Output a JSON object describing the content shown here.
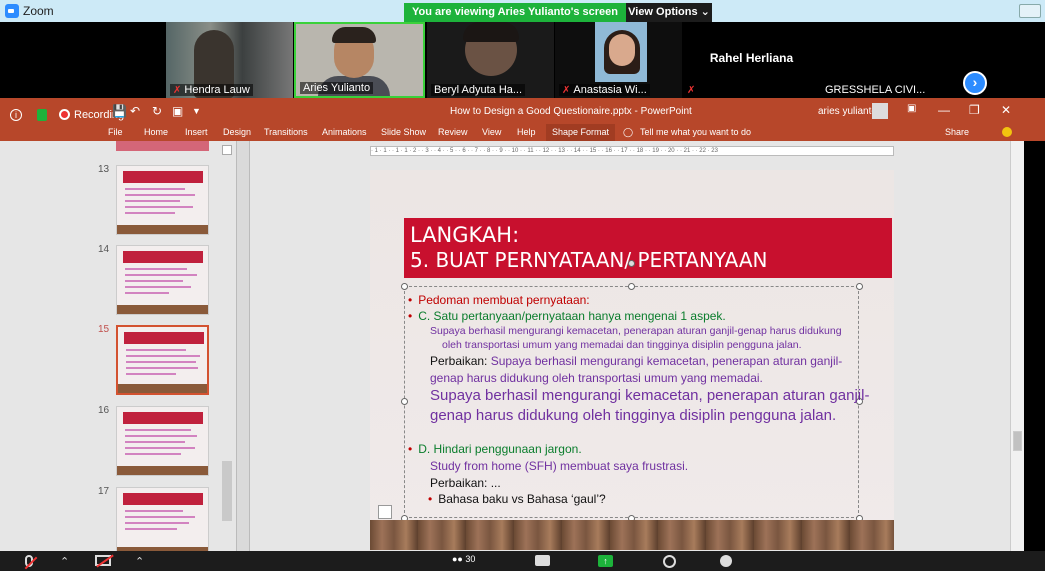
{
  "zoom": {
    "app_name": "Zoom",
    "viewing_banner": "You are viewing Aries Yulianto's screen",
    "view_options": "View Options ⌄",
    "recording_label": "Recording",
    "gallery": [
      {
        "name": "Hendra Lauw",
        "muted": true
      },
      {
        "name": "Aries Yulianto",
        "muted": false
      },
      {
        "name": "Beryl Adyuta Ha...",
        "muted": false
      },
      {
        "name": "Anastasia Wi...",
        "muted": true
      },
      {
        "name": "Rahel Herliana",
        "muted": true
      },
      {
        "name": "GRESSHELA CIVI...",
        "muted": false
      }
    ],
    "participants_count": "30"
  },
  "ppt": {
    "doc_title": "How to Design a Good Questionaire.pptx  -  PowerPoint",
    "user_name": "aries yulianto",
    "tabs": [
      "File",
      "Home",
      "Insert",
      "Design",
      "Transitions",
      "Animations",
      "Slide Show",
      "Review",
      "View",
      "Help",
      "Shape Format"
    ],
    "tell_me": "Tell me what you want to do",
    "share": "Share",
    "ruler_text": "· 1 · 1 · · 1 · 1 · 2 · · 3 · · 4 · · 5 · · 6 · · 7 · · 8 · · 9 · · 10 · · 11 · · 12 · · 13 · · 14 · · 15 · · 16 · · 17 · · 18 · · 19 · · 20 · · 21 · · 22 · 23",
    "slide_numbers": [
      "13",
      "14",
      "15",
      "16",
      "17"
    ]
  },
  "slide": {
    "title_line1": "LANGKAH:",
    "title_line2": "5. BUAT PERNYATAAN/ PERTANYAAN",
    "pedoman": "Pedoman membuat pernyataan:",
    "c_point": "C. Satu pertanyaan/pernyataan hanya mengenai 1 aspek.",
    "c_ex1": "Supaya berhasil mengurangi kemacetan, penerapan aturan ganjil-genap harus didukung",
    "c_ex2": "oleh transportasi umum yang memadai dan tingginya disiplin pengguna jalan.",
    "c_fix_label": "Perbaikan:",
    "c_fix1": " Supaya berhasil mengurangi kemacetan, penerapan aturan ganjil-",
    "c_fix2": "genap harus didukung oleh transportasi umum yang memadai.",
    "c_fix3": "Supaya berhasil mengurangi kemacetan, penerapan aturan ganjil-",
    "c_fix4": "genap harus didukung oleh tingginya disiplin pengguna jalan.",
    "d_point": "D. Hindari penggunaan jargon.",
    "d_ex": "Study from home (SFH) membuat saya frustrasi.",
    "d_fix_label": "Perbaikan: ...",
    "d_sub": "Bahasa baku vs Bahasa ‘gaul’?"
  }
}
